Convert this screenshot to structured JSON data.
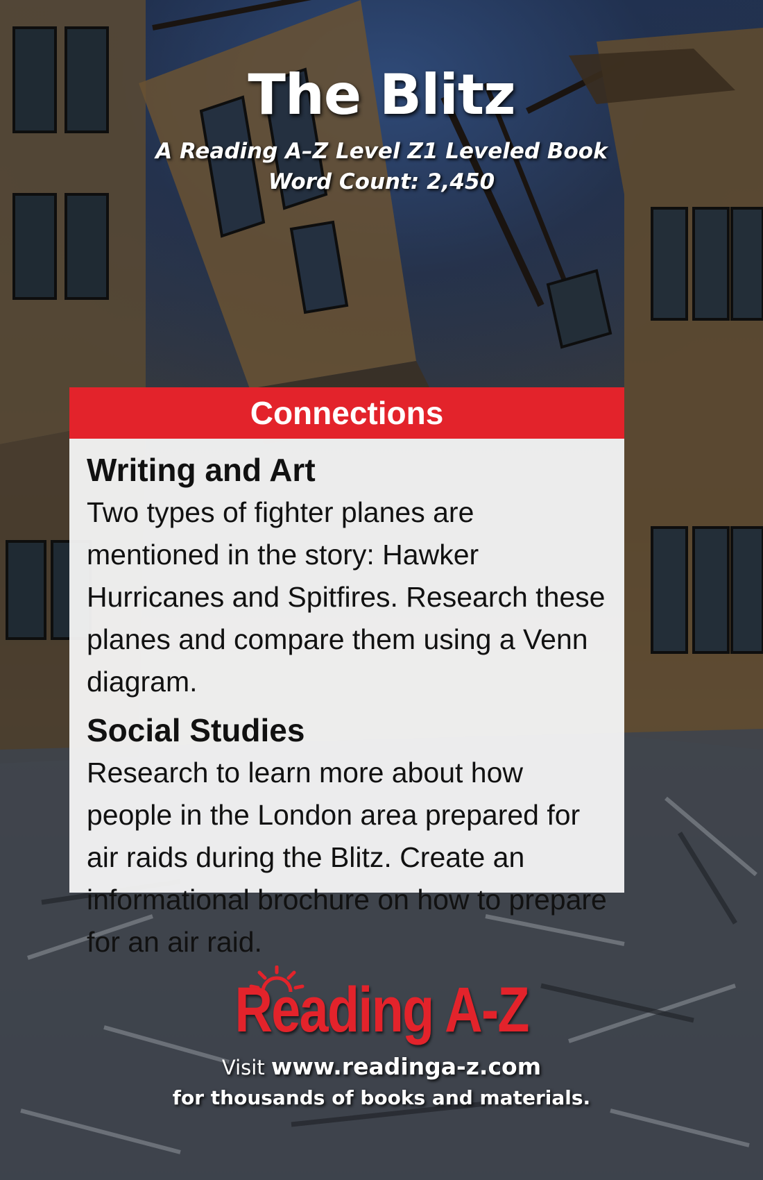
{
  "book": {
    "title": "The Blitz",
    "subtitle": "A Reading A–Z Level Z1 Leveled Book",
    "word_count": "Word Count: 2,450"
  },
  "connections": {
    "header": "Connections",
    "sections": [
      {
        "heading": "Writing and Art",
        "text": "Two types of fighter planes are mentioned in the story: Hawker Hurricanes and Spitfires. Research these planes and compare them using a Venn diagram."
      },
      {
        "heading": "Social Studies",
        "text": "Research to learn more about how people in the London area prepared for air raids during the Blitz. Create an informational brochure on how to prepare for an air raid."
      }
    ]
  },
  "brand": {
    "logo_text": "Reading A-Z",
    "visit_prefix": "Visit",
    "url": "www.readinga-z.com",
    "tagline": "for thousands of books and materials."
  },
  "colors": {
    "accent_red": "#e3232b",
    "card_bg": "#f5f5f5",
    "sky_blue": "#2f4a78"
  }
}
